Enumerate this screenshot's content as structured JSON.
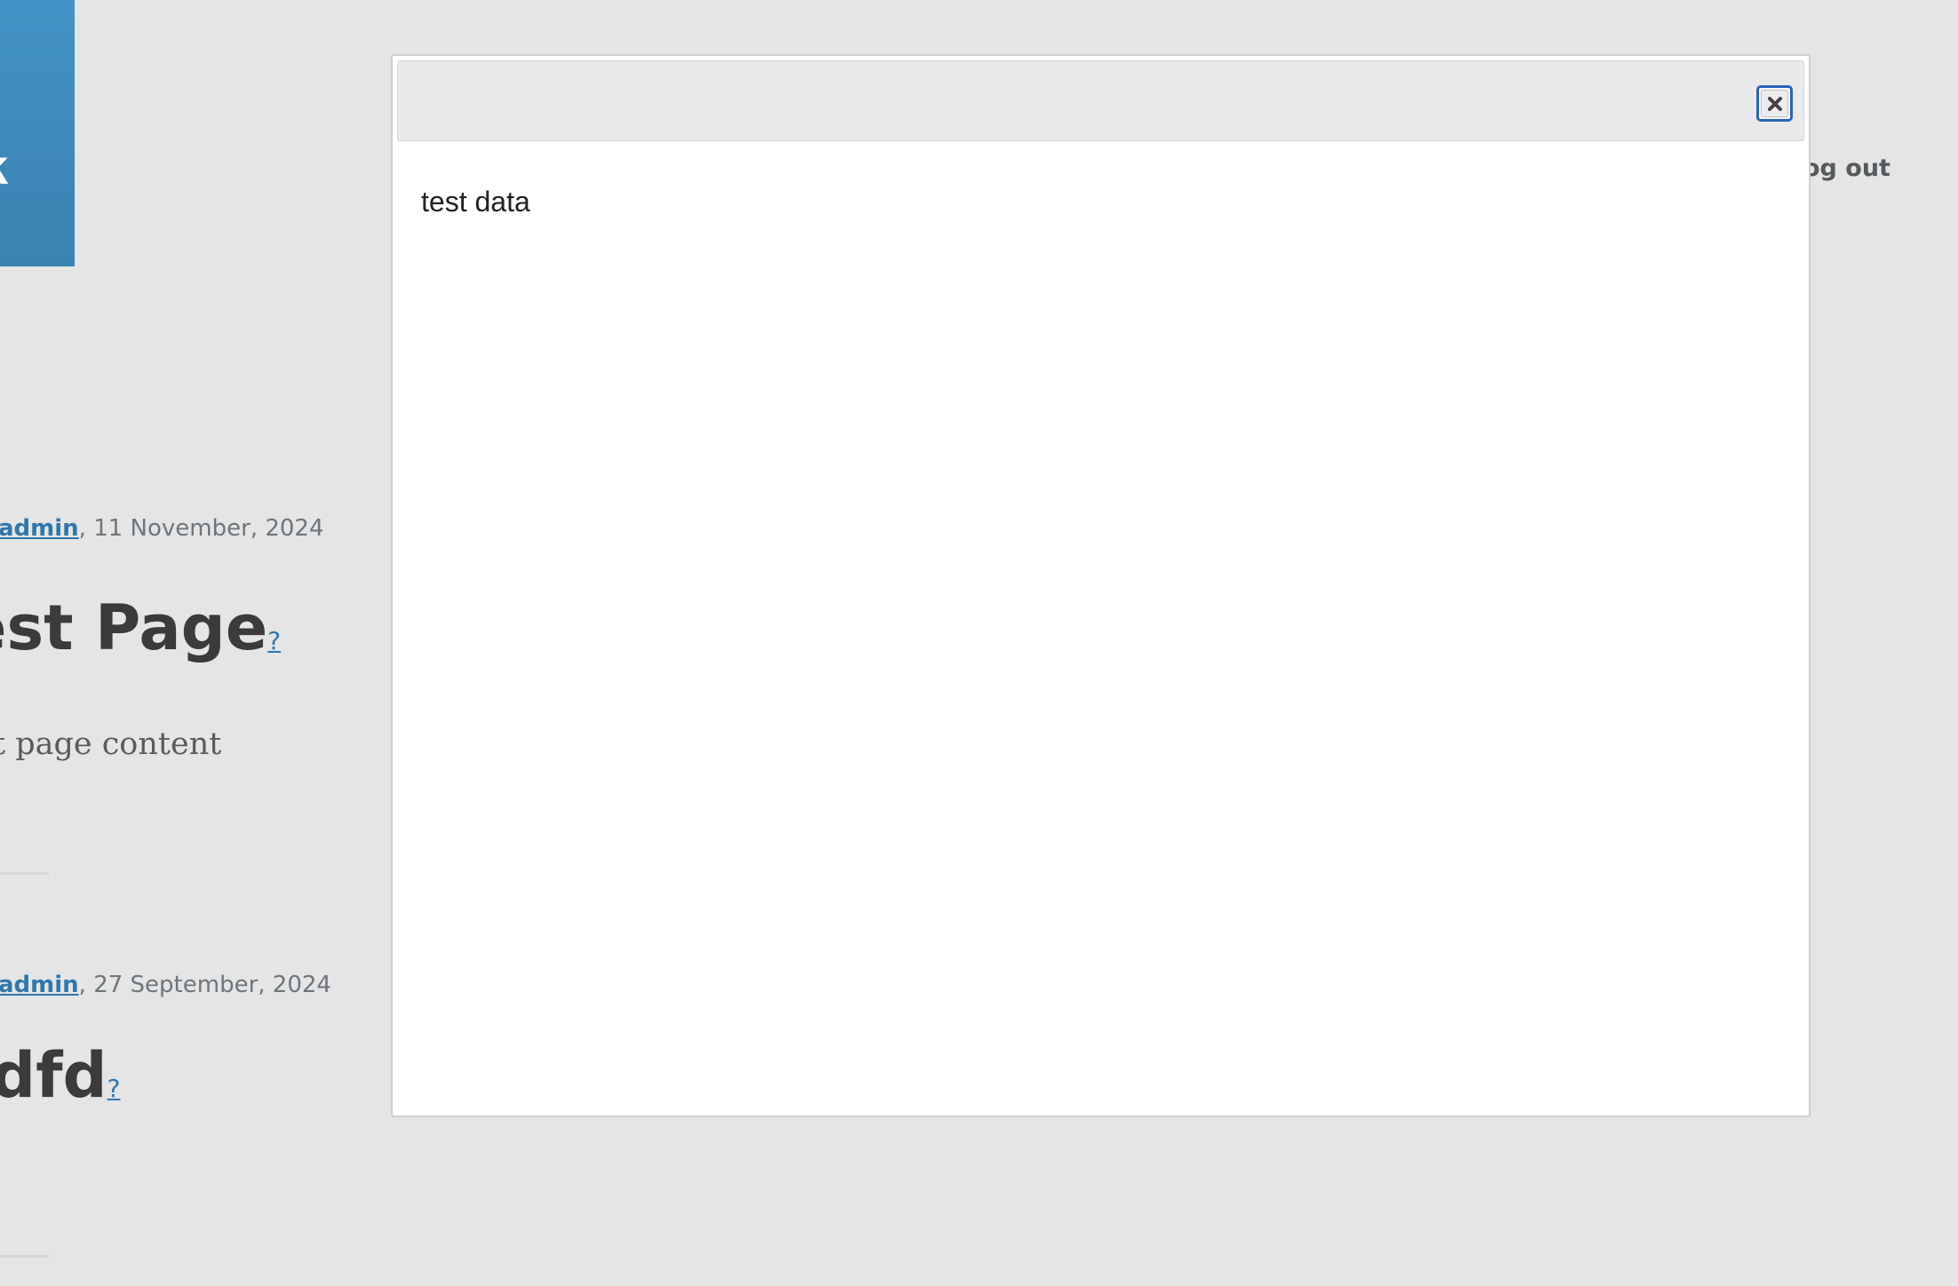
{
  "header": {
    "brand_letter": "k",
    "logout_label": "og out"
  },
  "posts": [
    {
      "author": "admin",
      "date": ", 11 November, 2024",
      "title": "est Page",
      "title_link": "?",
      "body": "t page content"
    },
    {
      "author": "admin",
      "date": ", 27 September, 2024",
      "title": "dfd",
      "title_link": "?",
      "body": ""
    }
  ],
  "dialog": {
    "content": "test data",
    "close_icon": "close-icon"
  },
  "colors": {
    "page_bg": "#e5e5e5",
    "brand": "#3f8bbf",
    "link": "#2f77ad",
    "focus_ring": "#2b63b8"
  }
}
